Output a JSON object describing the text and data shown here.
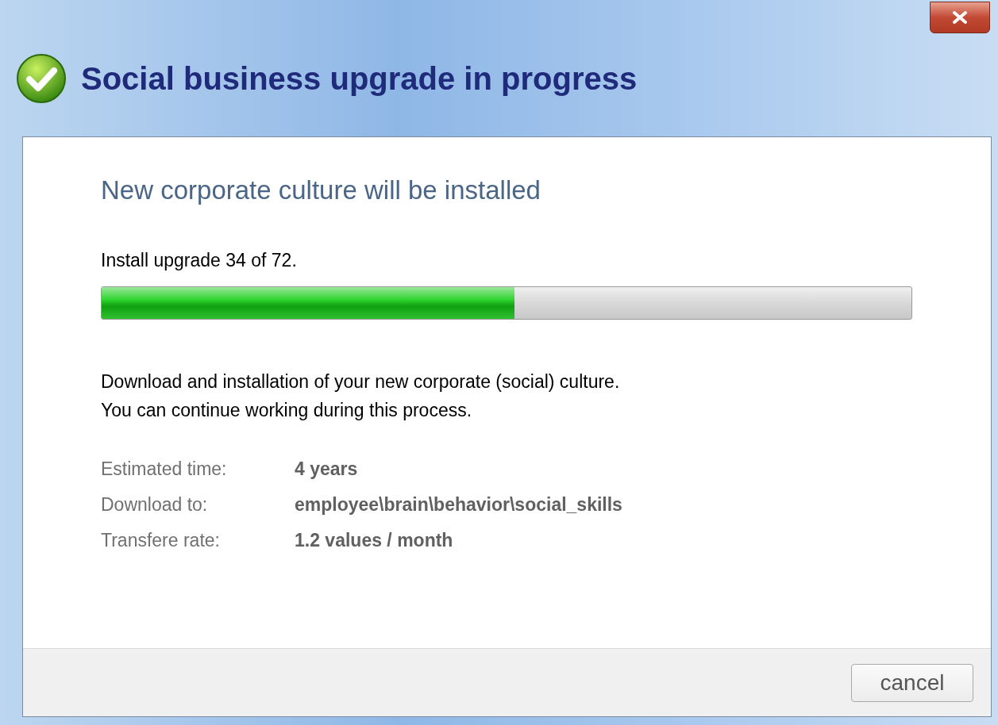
{
  "window": {
    "title": "Social business upgrade in progress"
  },
  "heading": "New corporate culture will be installed",
  "progress": {
    "label": "Install upgrade 34 of 72.",
    "level": 0.51
  },
  "description": [
    "Download and installation of your new corporate (social) culture.",
    "You can continue working during this process."
  ],
  "details": [
    {
      "label": "Estimated time:",
      "value": "4 years"
    },
    {
      "label": "Download to:",
      "value": "employee\\brain\\behavior\\social_skills"
    },
    {
      "label": "Transfere rate:",
      "value": "1.2 values / month"
    }
  ],
  "buttons": [
    "cancel"
  ]
}
